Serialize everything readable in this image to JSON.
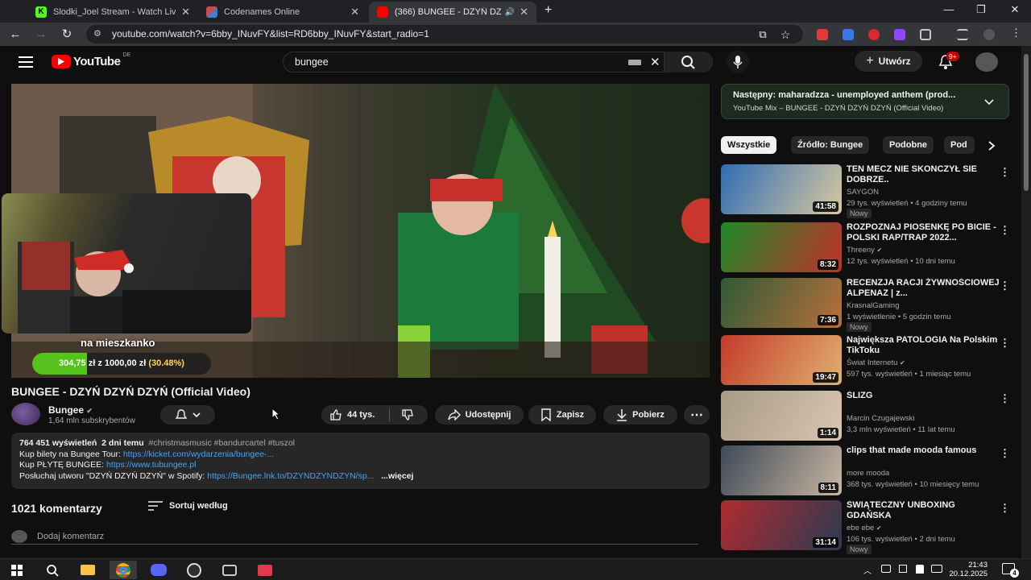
{
  "browser": {
    "tabs": [
      {
        "title": "Slodki_Joel Stream - Watch Live",
        "favicon_color": "#53fc18"
      },
      {
        "title": "Codenames Online",
        "favicon_color": "#c94b4b"
      },
      {
        "title": "(366) BUNGEE - DZYŃ DZYŃ DZYŃ (Official Video) - YouTube",
        "favicon_color": "#ff0000"
      }
    ],
    "new_tab": "+",
    "url": "youtube.com/watch?v=6bby_INuvFY&list=RD6bby_INuvFY&start_radio=1",
    "window_controls": [
      "—",
      "❐",
      "✕"
    ]
  },
  "youtube": {
    "logo_text": "YouTube",
    "region": "DE",
    "search_value": "bungee",
    "create_label": "Utwórz",
    "notif_count": "9+"
  },
  "video": {
    "overlay_text": "na mieszkanko",
    "goal_current": "304,75 zł",
    "goal_sep": "z",
    "goal_total": "1000,00 zł",
    "goal_percent": "(30.48%)",
    "goal_fraction": 0.3048,
    "title": "BUNGEE - DZYŃ DZYŃ DZYŃ (Official Video)"
  },
  "channel": {
    "name": "Bungee",
    "subs": "1,64 mln subskrybentów"
  },
  "actions": {
    "likes": "44 tys.",
    "share": "Udostępnij",
    "save": "Zapisz",
    "download": "Pobierz"
  },
  "description": {
    "views": "764 451 wyświetleń",
    "age": "2 dni temu",
    "tags": "#christmasmusic #bandurcartel #tuszol",
    "line2_label": "Kup bilety na Bungee Tour: ",
    "line2_link": "https://kicket.com/wydarzenia/bungee-...",
    "line3_label": "Kup PŁYTĘ BUNGEE: ",
    "line3_link": "https://www.tubungee.pl",
    "line4_label": "Posłuchaj utworu \"DZYŃ DZYŃ DZYŃ\" w Spotify: ",
    "line4_link": "https://Bungee.lnk.to/DZYNDZYNDZYN/sp...",
    "more": "...więcej"
  },
  "comments": {
    "count": "1021 komentarzy",
    "sort": "Sortuj według",
    "add": "Dodaj komentarz"
  },
  "up_next": {
    "title": "Następny: maharadzza - unemployed anthem (prod...",
    "subtitle": "YouTube Mix – BUNGEE - DZYŃ DZYŃ DZYŃ (Official Video)"
  },
  "chips": [
    "Wszystkie",
    "Źródło: Bungee",
    "Podobne",
    "Pod"
  ],
  "recommendations": [
    {
      "title": "TEN MECZ NIE SKONCZYŁ SIE DOBRZE..",
      "channel": "SAYGON",
      "meta": "29 tys. wyświetleń • 4 godziny temu",
      "badge": "Nowy",
      "duration": "41:58",
      "verified": false,
      "c1": "#2f6db5",
      "c2": "#d8c8a0"
    },
    {
      "title": "ROZPOZNAJ PIOSENKĘ PO BICIE - POLSKI RAP/TRAP 2022...",
      "channel": "Threeny",
      "meta": "12 tys. wyświetleń • 10 dni temu",
      "badge": "",
      "duration": "8:32",
      "verified": true,
      "c1": "#1d8a2a",
      "c2": "#c0302a"
    },
    {
      "title": "RECENZJA RACJI ŻYWNOŚCIOWEJ ALPENAZ | z...",
      "channel": "KrasnalGaming",
      "meta": "1 wyświetlenie • 5 godzin temu",
      "badge": "Nowy",
      "duration": "7:36",
      "verified": false,
      "c1": "#2d5a38",
      "c2": "#b8703a"
    },
    {
      "title": "Największa PATOLOGIA Na Polskim TikToku",
      "channel": "Świat Internetu",
      "meta": "597 tys. wyświetleń • 1 miesiąc temu",
      "badge": "",
      "duration": "19:47",
      "verified": true,
      "c1": "#c43b2b",
      "c2": "#e0b070"
    },
    {
      "title": "ŚLIZG",
      "channel": "Marcin Czugajewski",
      "meta": "3,3 mln wyświetleń • 11 lat temu",
      "badge": "",
      "duration": "1:14",
      "verified": false,
      "c1": "#a89a86",
      "c2": "#d8c6b0"
    },
    {
      "title": "clips that made mooda famous",
      "channel": "more mooda",
      "meta": "368 tys. wyświetleń • 10 miesięcy temu",
      "badge": "",
      "duration": "8:11",
      "verified": false,
      "c1": "#3e4a58",
      "c2": "#c9b6a2"
    },
    {
      "title": "ŚWIĄTECZNY UNBOXING GDAŃSKA",
      "channel": "ebe ebe",
      "meta": "106 tys. wyświetleń • 2 dni temu",
      "badge": "Nowy",
      "duration": "31:14",
      "verified": true,
      "c1": "#b02a2e",
      "c2": "#2c3a52"
    }
  ],
  "taskbar": {
    "time": "21:43",
    "date": "20.12.2025",
    "notif": "4"
  }
}
